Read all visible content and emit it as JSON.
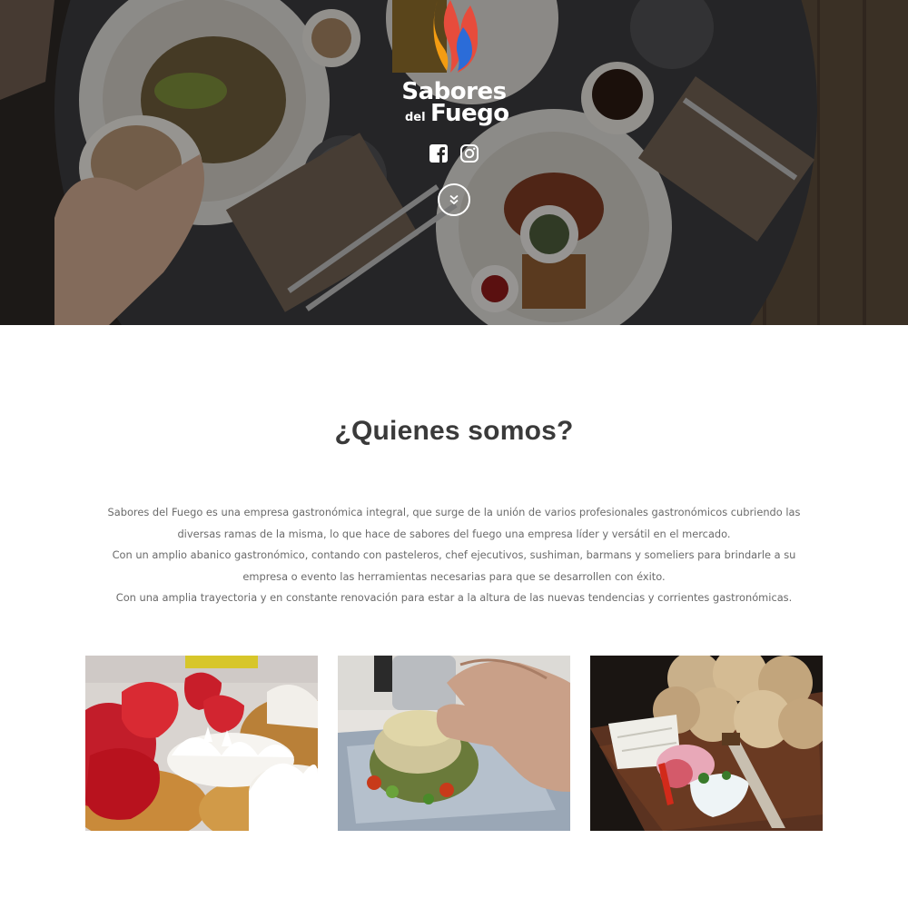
{
  "brand": {
    "name_line1": "Sabores",
    "name_del": "del",
    "name_line2": "Fuego",
    "flame_colors": [
      "#f39c12",
      "#e74c3c",
      "#2b6cd8"
    ]
  },
  "social": [
    {
      "icon": "facebook-icon"
    },
    {
      "icon": "instagram-icon"
    }
  ],
  "scroll_icon": "chevron-double-down-icon",
  "about": {
    "title": "¿Quienes somos?",
    "paragraphs": [
      "Sabores del Fuego es una empresa gastronómica integral, que surge de la unión de varios profesionales gastronómicos cubriendo las diversas ramas de la misma, lo que hace de sabores del fuego una empresa líder y versátil en el mercado.",
      "Con un amplio abanico gastronómico, contando con pasteleros, chef ejecutivos, sushiman, barmans y someliers para brindarle a su empresa o evento las herramientas necesarias para que se desarrollen con éxito.",
      "Con una amplia trayectoria y en constante renovación para estar a la altura de las nuevas tendencias y corrientes gastronómicas."
    ]
  },
  "gallery": [
    {
      "subject": "strawberry-meringue-tarts"
    },
    {
      "subject": "chef-plating-dish"
    },
    {
      "subject": "bread-and-cheese-board"
    }
  ]
}
